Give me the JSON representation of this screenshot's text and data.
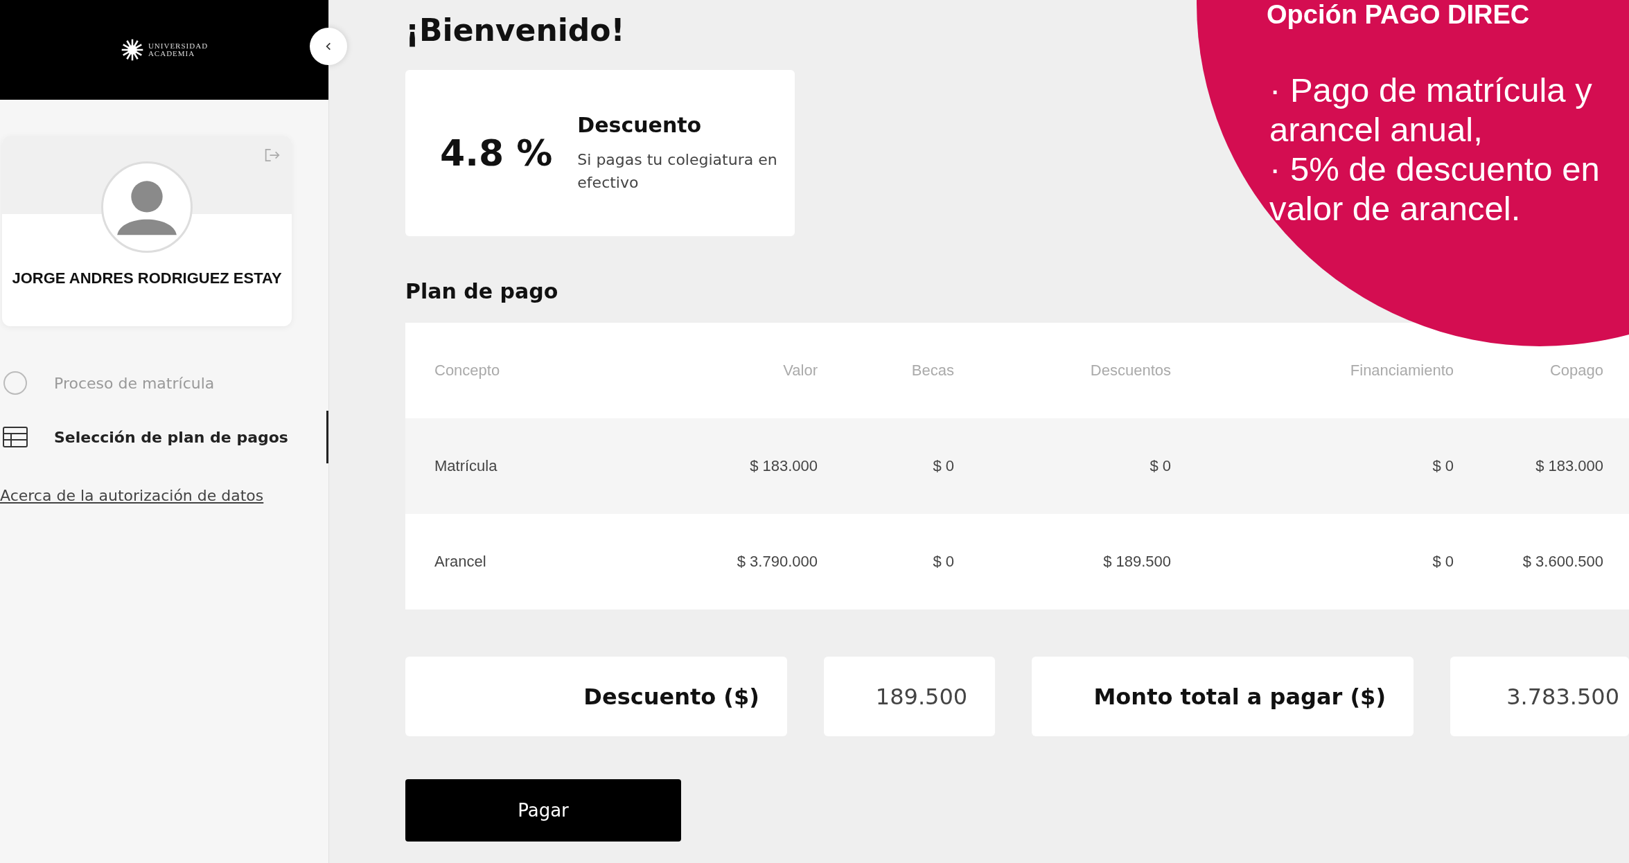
{
  "sidebar": {
    "logo": {
      "line1": "UNIVERSIDAD",
      "line2": "ACADEMIA"
    },
    "profile": {
      "name": "JORGE ANDRES RODRIGUEZ ESTAY"
    },
    "items": [
      {
        "label": "Proceso de matrícula",
        "kind": "progress",
        "selected": false
      },
      {
        "label": "Selección de plan de pagos",
        "kind": "table",
        "selected": true
      }
    ],
    "link": "Acerca de la autorización de datos"
  },
  "title": "¡Bienvenido!",
  "discount_card": {
    "value": "4.8 %",
    "heading": "Descuento",
    "text": "Si pagas tu colegiatura en efectivo"
  },
  "plan": {
    "title": "Plan de pago",
    "columns": [
      "Concepto",
      "Valor",
      "Becas",
      "Descuentos",
      "Financiamiento",
      "Copago"
    ],
    "rows": [
      [
        "Matrícula",
        "$ 183.000",
        "$ 0",
        "$ 0",
        "$ 0",
        "$ 183.000"
      ],
      [
        "Arancel",
        "$ 3.790.000",
        "$ 0",
        "$ 189.500",
        "$ 0",
        "$ 3.600.500"
      ]
    ]
  },
  "summary": [
    {
      "label": "Descuento ($)",
      "value": "189.500"
    },
    {
      "label": "Monto total a pagar ($)",
      "value": "3.783.500"
    }
  ],
  "pay_button": "Pagar",
  "callout": {
    "title": "Opción PAGO DIREC",
    "bullets": [
      "· Pago de matrícula y arancel anual,",
      "· 5% de descuento en valor de arancel."
    ]
  }
}
